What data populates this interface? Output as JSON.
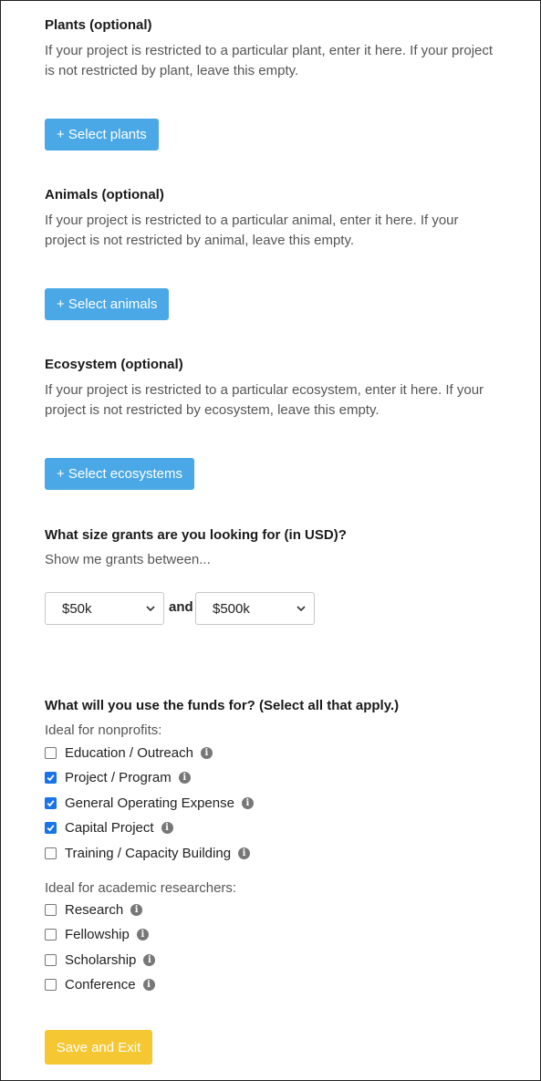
{
  "plants": {
    "title": "Plants (optional)",
    "description": "If your project is restricted to a particular plant, enter it here. If your project is not restricted by plant, leave this empty.",
    "button": "+ Select plants"
  },
  "animals": {
    "title": "Animals (optional)",
    "description": "If your project is restricted to a particular animal, enter it here. If your project is not restricted by animal, leave this empty.",
    "button": "+ Select animals"
  },
  "ecosystem": {
    "title": "Ecosystem (optional)",
    "description": "If your project is restricted to a particular ecosystem, enter it here. If your project is not restricted by ecosystem, leave this empty.",
    "button": "+ Select ecosystems"
  },
  "grant_size": {
    "title": "What size grants are you looking for (in USD)?",
    "subtitle": "Show me grants between...",
    "min_value": "$50k",
    "and_label": "and",
    "max_value": "$500k"
  },
  "funds": {
    "title": "What will you use the funds for? (Select all that apply.)",
    "nonprofits_label": "Ideal for nonprofits:",
    "nonprofit_options": [
      {
        "label": "Education / Outreach",
        "checked": false
      },
      {
        "label": "Project / Program",
        "checked": true
      },
      {
        "label": "General Operating Expense",
        "checked": true
      },
      {
        "label": "Capital Project",
        "checked": true
      },
      {
        "label": "Training / Capacity Building",
        "checked": false
      }
    ],
    "academic_label": "Ideal for academic researchers:",
    "academic_options": [
      {
        "label": "Research",
        "checked": false
      },
      {
        "label": "Fellowship",
        "checked": false
      },
      {
        "label": "Scholarship",
        "checked": false
      },
      {
        "label": "Conference",
        "checked": false
      }
    ],
    "info_icon": "info-circle-icon"
  },
  "save_button": "Save and Exit",
  "colors": {
    "primary_button": "#4aa8e6",
    "save_button": "#f5c733",
    "checkbox_checked": "#1a73e8"
  }
}
